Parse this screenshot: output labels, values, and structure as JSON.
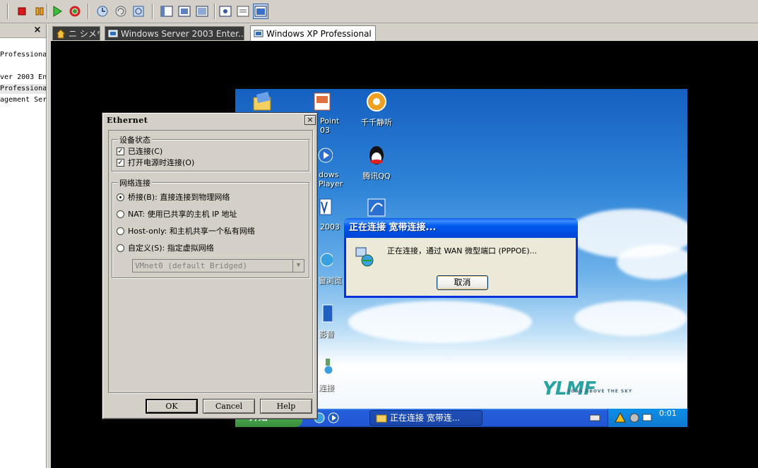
{
  "toolbar": {
    "buttons": [
      "stop-icon",
      "pause-icon",
      "play-icon",
      "reset-icon",
      "snapshot-icon",
      "revert-snapshot-icon",
      "snapshot-manager-icon",
      "sidebar-toggle-icon",
      "fullscreen-icon",
      "quick-switch-icon",
      "console-view-icon",
      "summary-view-icon",
      "unity-icon"
    ]
  },
  "sidebar": {
    "close_label": "×",
    "items": [
      "Professiona",
      "ver 2003 Ent",
      "Professional",
      "agement Serv"
    ]
  },
  "tabs": [
    {
      "label": "ニ シメウ",
      "icon": "home-icon"
    },
    {
      "label": "Windows Server 2003 Enter...",
      "icon": "vm-icon"
    },
    {
      "label": "Windows XP Professional",
      "icon": "vm-icon"
    }
  ],
  "desktop": {
    "icons": [
      {
        "label": "",
        "icon": "folder-mail-icon"
      },
      {
        "label": "Point\n03",
        "icon": "powerpoint-icon"
      },
      {
        "label": "千千静听",
        "icon": "ttplayer-icon"
      },
      {
        "label": "dows\nPlayer",
        "icon": "media-player-icon"
      },
      {
        "label": "腾讯QQ",
        "icon": "qq-icon"
      },
      {
        "label": "2003",
        "icon": "word-icon"
      },
      {
        "label": "",
        "icon": "network-app-icon"
      },
      {
        "label": "窗浏览",
        "icon": "browser-icon"
      },
      {
        "label": "影音",
        "icon": "video-icon"
      },
      {
        "label": "连接",
        "icon": "network-connection-icon"
      }
    ],
    "logo": "YLMF",
    "logo_sub": "SOAR ABOVE THE SKY"
  },
  "taskbar": {
    "start_label": "开始",
    "task_label": "正在连接 宽带连...",
    "clock": "0:01"
  },
  "connect_dialog": {
    "title": "正在连接 宽带连接...",
    "message": "正在连接，通过 WAN 微型端口 (PPPOE)...",
    "cancel_label": "取消"
  },
  "ethernet_dialog": {
    "title": "Ethernet",
    "close_label": "×",
    "device_status": {
      "label": "设备状态",
      "connected": {
        "label": "已连接(C)",
        "checked": true
      },
      "connect_at_power_on": {
        "label": "打开电源时连接(O)",
        "checked": true
      }
    },
    "network_connection": {
      "label": "网络连接",
      "options": [
        {
          "label": "桥接(B): 直接连接到物理网络",
          "selected": true
        },
        {
          "label": "NAT: 使用已共享的主机 IP 地址",
          "selected": false
        },
        {
          "label": "Host-only: 和主机共享一个私有网络",
          "selected": false
        },
        {
          "label": "自定义(S): 指定虚拟网络",
          "selected": false
        }
      ],
      "custom_select_value": "VMnet0 (default Bridged)"
    },
    "ok_label": "OK",
    "cancel_label": "Cancel",
    "help_label": "Help"
  }
}
